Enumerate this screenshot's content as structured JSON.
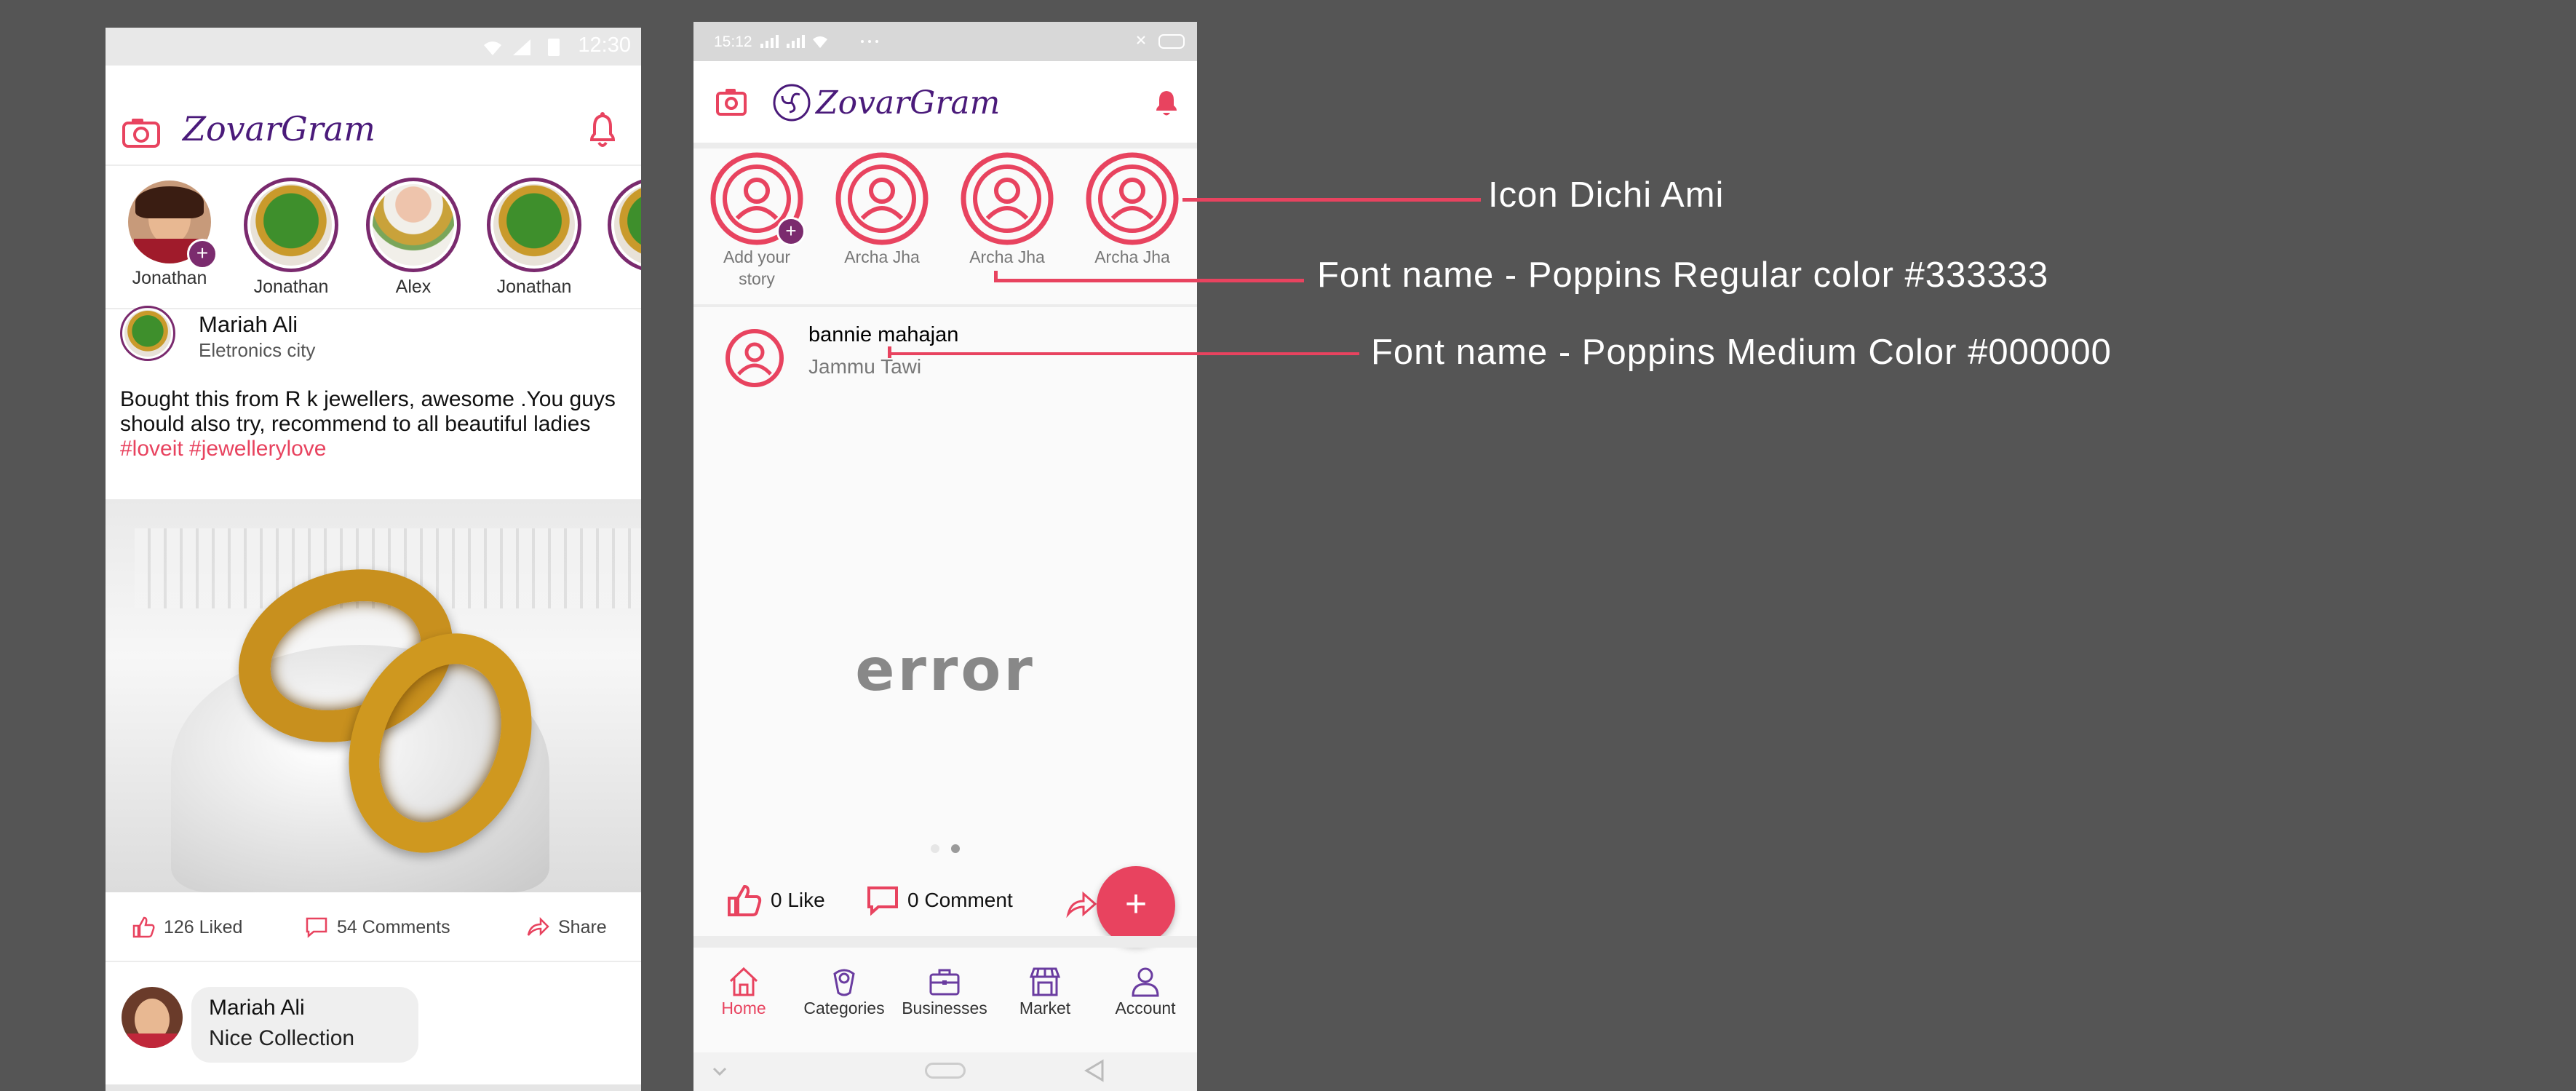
{
  "left_phone": {
    "status_time": "12:30",
    "logo_text": "ZovarGram",
    "stories": [
      {
        "name": "Jonathan",
        "has_add": true,
        "style": "portrait"
      },
      {
        "name": "Jonathan",
        "has_add": false,
        "style": "green"
      },
      {
        "name": "Alex",
        "has_add": false,
        "style": "necklace"
      },
      {
        "name": "Jonathan",
        "has_add": false,
        "style": "green"
      },
      {
        "name": "",
        "has_add": false,
        "style": "green"
      }
    ],
    "post": {
      "user_name": "Mariah Ali",
      "user_location": "Eletronics city",
      "text": "Bought this from R k jewellers, awesome .You guys should also try, recommend to all beautiful ladies",
      "hashtags": "#loveit #jewellerylove",
      "likes": "126 Liked",
      "comments": "54 Comments",
      "share": "Share"
    },
    "comment": {
      "user_name": "Mariah Ali",
      "text": "Nice Collection"
    }
  },
  "right_phone": {
    "status_time": "15:12",
    "logo_text": "ZovarGram",
    "stories": [
      {
        "label_line1": "Add your",
        "label_line2": "story",
        "has_add": true
      },
      {
        "label_line1": "Archa Jha",
        "label_line2": "",
        "has_add": false
      },
      {
        "label_line1": "Archa Jha",
        "label_line2": "",
        "has_add": false
      },
      {
        "label_line1": "Archa Jha",
        "label_line2": "",
        "has_add": false
      }
    ],
    "post": {
      "user_name": "bannie mahajan",
      "user_location": "Jammu Tawi",
      "error_text": "error",
      "like_label": "0 Like",
      "comment_label": "0 Comment"
    },
    "bottom_nav": [
      {
        "label": "Home",
        "icon": "home-icon",
        "active": true
      },
      {
        "label": "Categories",
        "icon": "categories-icon",
        "active": false
      },
      {
        "label": "Businesses",
        "icon": "businesses-icon",
        "active": false
      },
      {
        "label": "Market",
        "icon": "market-icon",
        "active": false
      },
      {
        "label": "Account",
        "icon": "account-icon",
        "active": false
      }
    ]
  },
  "annotations": {
    "icon_note": "Icon Dichi Ami",
    "regular_font_note": "Font name - Poppins Regular color #333333",
    "medium_font_note": "Font name - Poppins Medium Color #000000"
  },
  "colors": {
    "accent": "#e8435f",
    "purple": "#4a1a7a",
    "background": "#555555"
  }
}
